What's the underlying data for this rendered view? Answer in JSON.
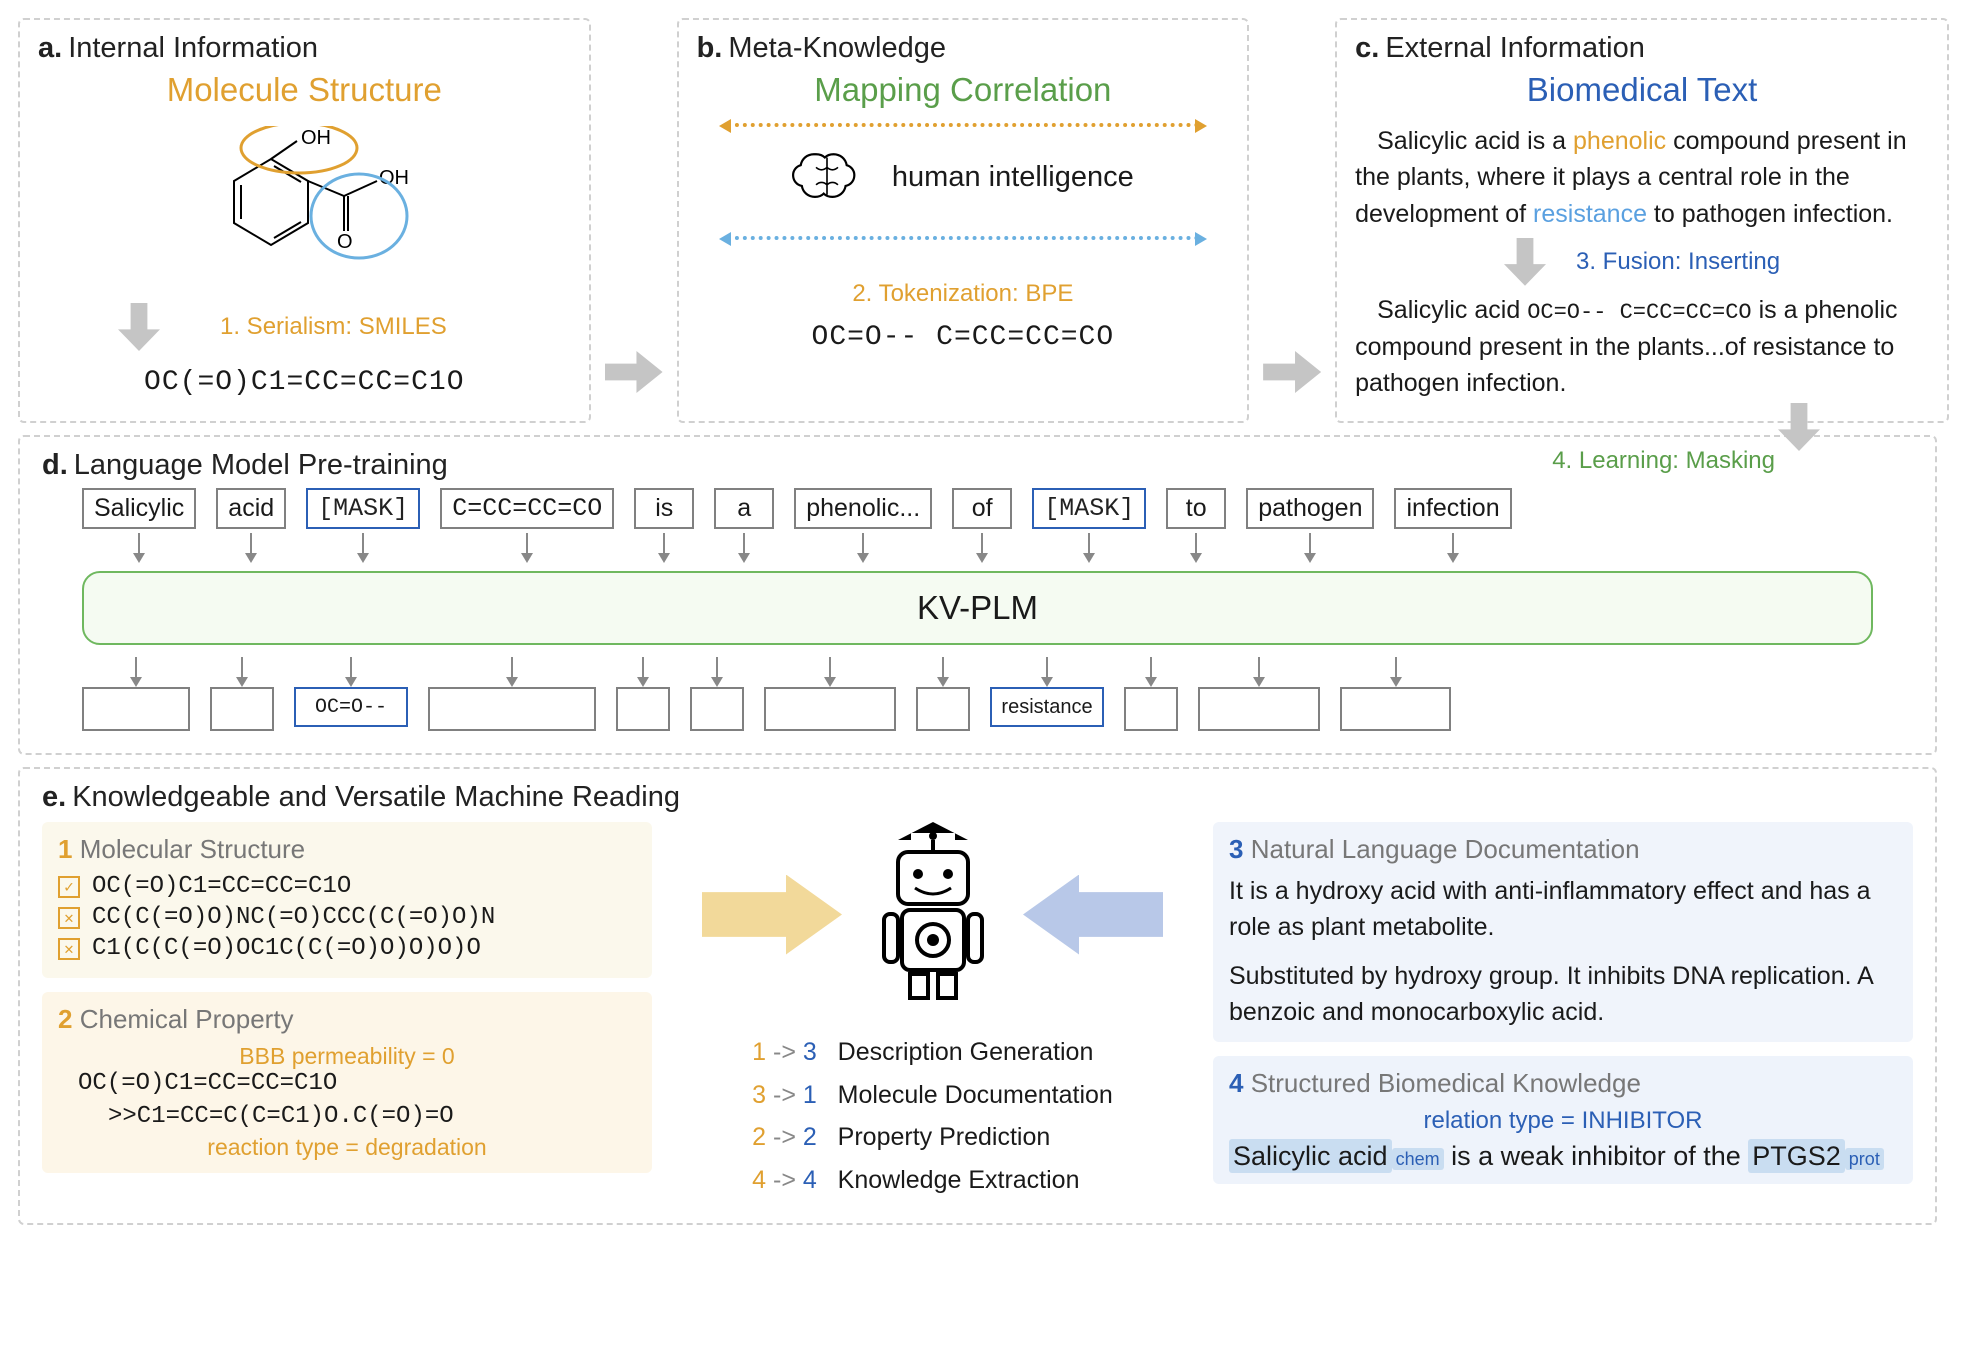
{
  "panelA": {
    "letter": "a.",
    "title": "Internal Information",
    "subtitle": "Molecule Structure",
    "mol_oh": "OH",
    "mol_o": "O",
    "mol_oh2": "OH",
    "step": "1. Serialism: SMILES",
    "smiles": "OC(=O)C1=CC=CC=C1O"
  },
  "panelB": {
    "letter": "b.",
    "title": "Meta-Knowledge",
    "subtitle": "Mapping Correlation",
    "human_intelligence": "human intelligence",
    "step": "2. Tokenization: BPE",
    "tokens": "OC=O--  C=CC=CC=CO"
  },
  "panelC": {
    "letter": "c.",
    "title": "External Information",
    "subtitle": "Biomedical Text",
    "para1_pre": "Salicylic acid is a ",
    "para1_phenolic": "phenolic",
    "para1_mid": " compound present in the plants, where it plays a central role in the development of ",
    "para1_resistance": "resistance",
    "para1_end": " to pathogen infection.",
    "step3": "3. Fusion: Inserting",
    "para2_pre": "Salicylic acid ",
    "para2_tok": "OC=O--  C=CC=CC=CO",
    "para2_end": " is a phenolic compound present in the plants...of resistance to pathogen infection."
  },
  "panelD": {
    "letter": "d.",
    "title": "Language Model Pre-training",
    "step4": "4. Learning: Masking",
    "tokens_in": [
      "Salicylic",
      "acid",
      "[MASK]",
      "C=CC=CC=CO",
      "is",
      "a",
      "phenolic...",
      "of",
      "[MASK]",
      "to",
      "pathogen",
      "infection"
    ],
    "token_mask_idx": [
      2,
      8
    ],
    "token_mono_idx": [
      2,
      3,
      8
    ],
    "model_name": "KV-PLM",
    "out_filled": {
      "2": "OC=O--",
      "8": "resistance"
    }
  },
  "panelE": {
    "letter": "e.",
    "title": "Knowledgeable and Versatile Machine Reading",
    "card1": {
      "num": "1",
      "title": "Molecular Structure",
      "rows": [
        {
          "ok": true,
          "text": "OC(=O)C1=CC=CC=C1O"
        },
        {
          "ok": false,
          "text": "CC(C(=O)O)NC(=O)CCC(C(=O)O)N"
        },
        {
          "ok": false,
          "text": "C1(C(C(=O)OC1C(C(=O)O)O)O)O"
        }
      ]
    },
    "card2": {
      "num": "2",
      "title": "Chemical Property",
      "bbb": "BBB permeability = 0",
      "s1": "OC(=O)C1=CC=CC=C1O",
      "s2": ">>C1=CC=C(C=C1)O.C(=O)=O",
      "rxn": "reaction type = degradation"
    },
    "tasks": [
      {
        "from": "1",
        "to": "3",
        "label": "Description Generation"
      },
      {
        "from": "3",
        "to": "1",
        "label": "Molecule Documentation"
      },
      {
        "from": "2",
        "to": "2",
        "label": "Property Prediction"
      },
      {
        "from": "4",
        "to": "4",
        "label": "Knowledge Extraction"
      }
    ],
    "card3": {
      "num": "3",
      "title": "Natural Language Documentation",
      "p1": "It is a hydroxy acid with anti-inflammatory effect and has a role as plant metabolite.",
      "p2": "Substituted by hydroxy group. It inhibits DNA replication. A benzoic and monocarboxylic acid."
    },
    "card4": {
      "num": "4",
      "title": "Structured Biomedical Knowledge",
      "relation": "relation type = INHIBITOR",
      "sent_pre": "Salicylic acid",
      "tag_chem": "chem",
      "sent_mid": "is a weak inhibitor of the ",
      "sent_ptgs": "PTGS2",
      "tag_prot": "prot"
    }
  },
  "colors": {
    "orange": "#e0a030",
    "green": "#5a9e4a",
    "blue": "#2b5fb5",
    "lightblue": "#5aa0e0",
    "arrow_gray": "#c5c5c5",
    "fat_yellow": "#f2d99a",
    "fat_blue": "#b8c8e8"
  }
}
